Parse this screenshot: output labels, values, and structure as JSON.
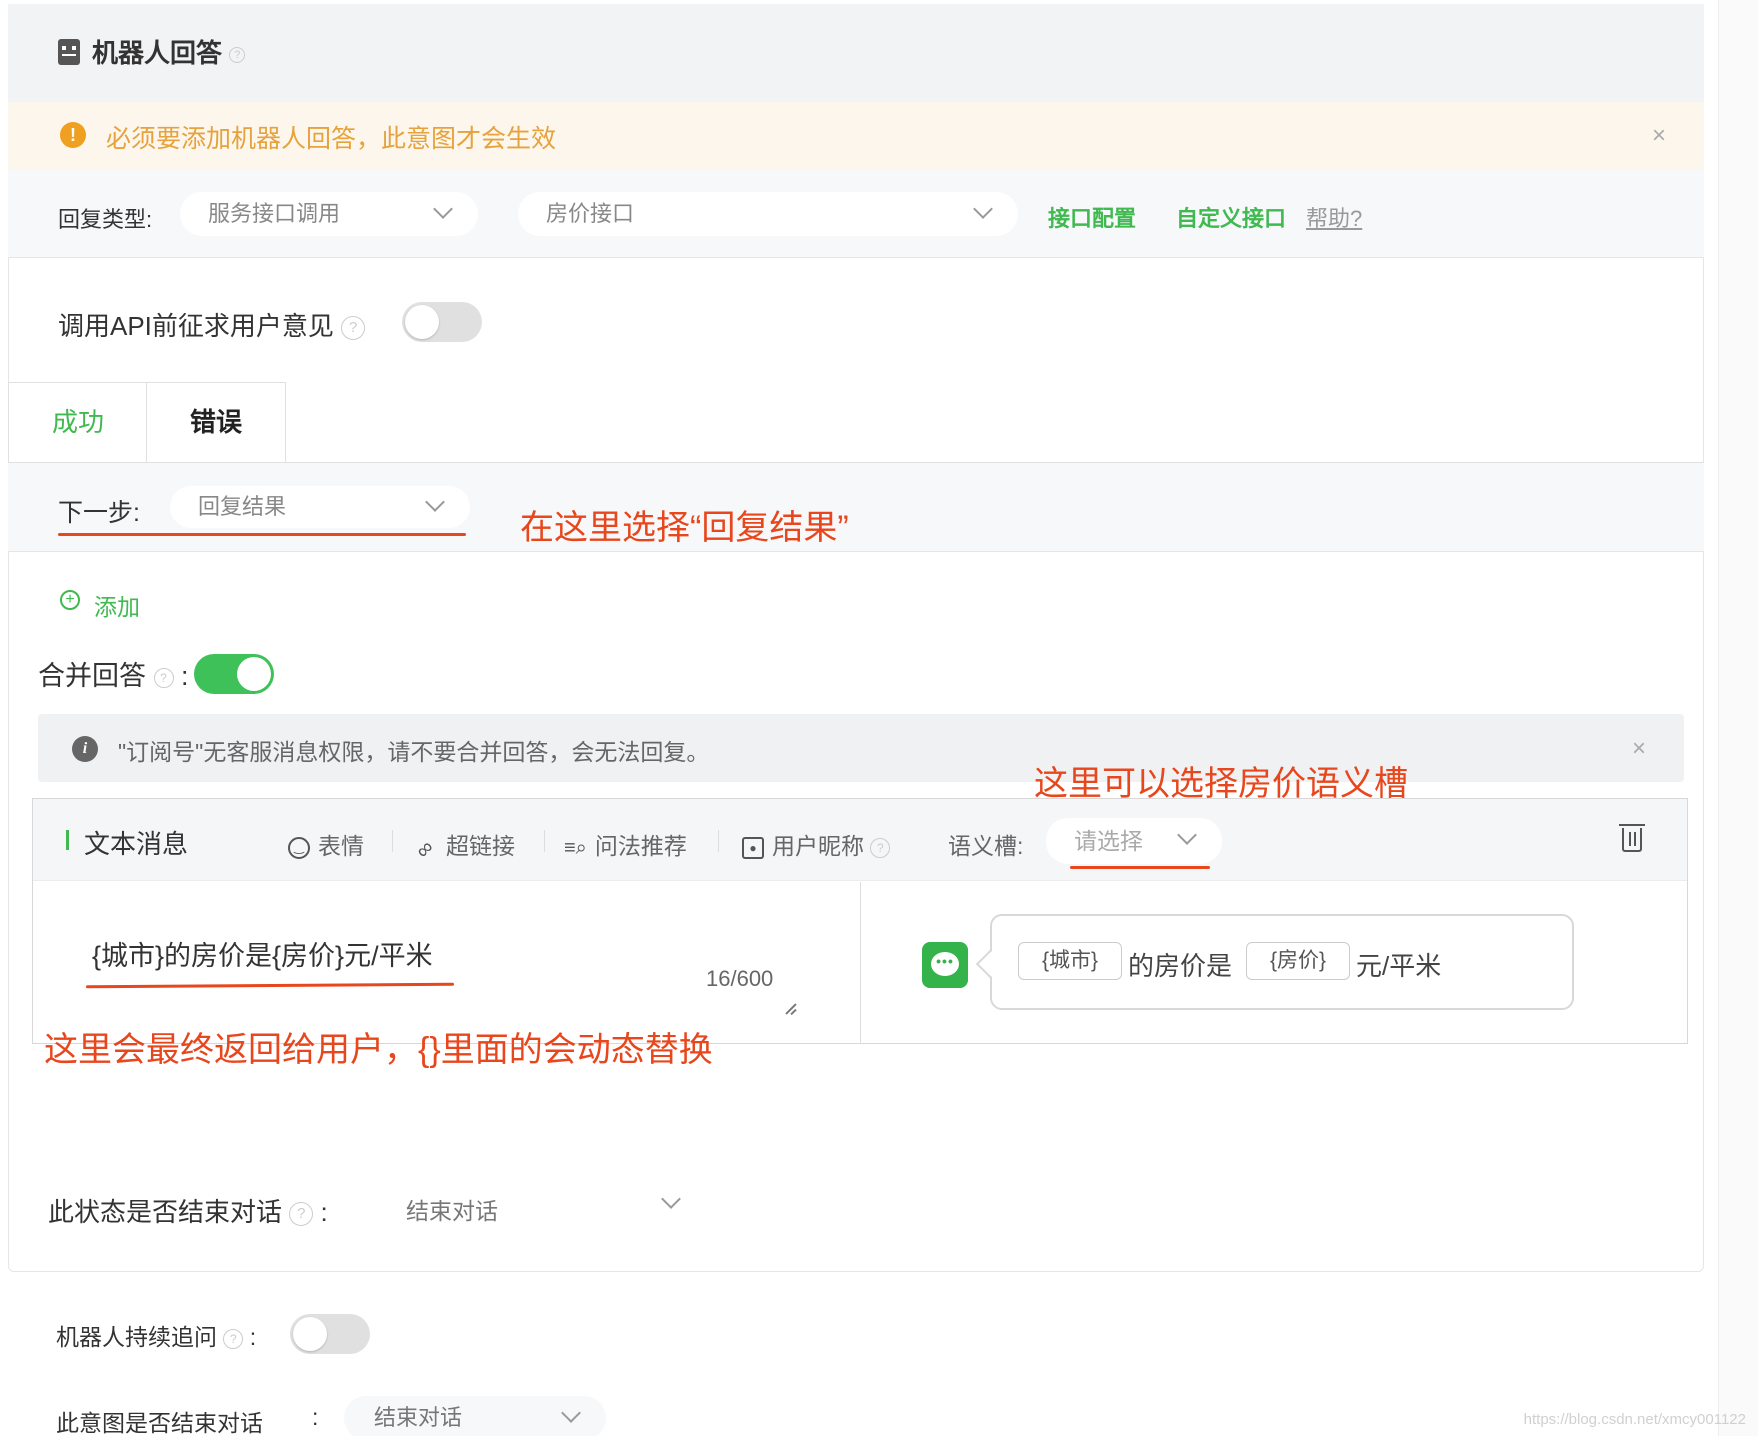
{
  "header": {
    "title": "机器人回答",
    "help": "?"
  },
  "warning": {
    "text": "必须要添加机器人回答，此意图才会生效",
    "close": "×"
  },
  "reply_type": {
    "label": "回复类型:",
    "type_value": "服务接口调用",
    "interface_value": "房价接口",
    "link_config": "接口配置",
    "link_custom": "自定义接口",
    "link_help": "帮助?"
  },
  "consent": {
    "label": "调用API前征求用户意见",
    "help": "?"
  },
  "tabs": [
    {
      "label": "成功"
    },
    {
      "label": "错误"
    }
  ],
  "next_step": {
    "label": "下一步:",
    "value": "回复结果"
  },
  "annotations": {
    "note_next": "在这里选择“回复结果”",
    "note_slot": "这里可以选择房价语义槽",
    "note_return": "这里会最终返回给用户，{}里面的会动态替换"
  },
  "add": {
    "label": "添加",
    "icon": "plus-circle-icon"
  },
  "merge": {
    "label": "合并回答",
    "help": "?",
    "colon": ":"
  },
  "info": {
    "text": "\"订阅号\"无客服消息权限，请不要合并回答，会无法回复。",
    "close": "×"
  },
  "message": {
    "type_label": "文本消息",
    "tools": {
      "emoji": "表情",
      "link": "超链接",
      "recommend": "问法推荐",
      "nickname": "用户昵称",
      "nickname_help": "?"
    },
    "slot_label": "语义槽:",
    "slot_placeholder": "请选择",
    "content": "{城市}的房价是{房价}元/平米",
    "counter": "16/600",
    "preview": {
      "chip_city": "{城市}",
      "text_mid": "的房价是",
      "chip_price": "{房价}",
      "text_end": "元/平米"
    }
  },
  "end_state": {
    "label": "此状态是否结束对话",
    "help": "?",
    "colon": ":",
    "value": "结束对话"
  },
  "robot_followup": {
    "label": "机器人持续追问",
    "help": "?",
    "colon": ":"
  },
  "intent_end": {
    "label": "此意图是否结束对话",
    "colon": ":",
    "value": "结束对话"
  },
  "watermark": "https://blog.csdn.net/xmcy001122",
  "colors": {
    "accent_green": "#3fb950",
    "warning_orange": "#e6a23c",
    "annotation_red": "#e8461c",
    "toggle_on": "#3fc15a"
  }
}
